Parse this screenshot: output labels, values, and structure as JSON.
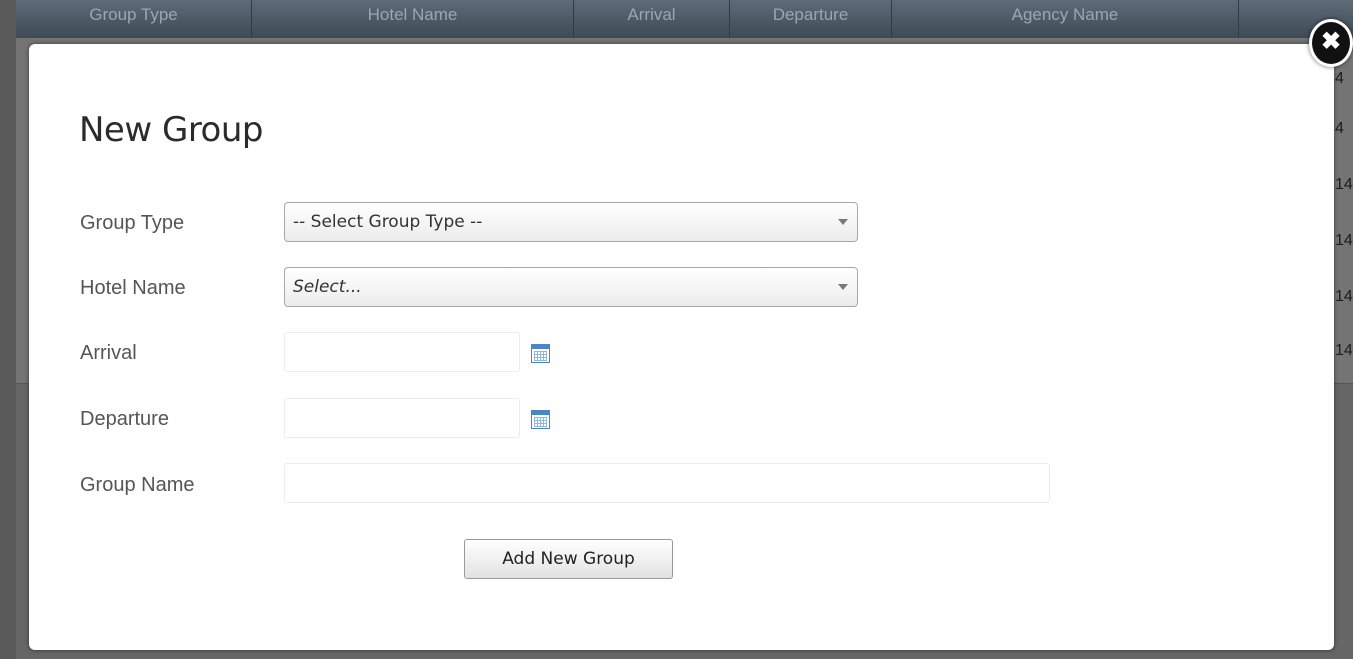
{
  "background_table": {
    "headers": [
      "Group Type",
      "Hotel Name",
      "Arrival",
      "Departure",
      "Agency Name"
    ],
    "row_fragments": [
      "4",
      "4",
      "14",
      "14",
      "14",
      "14"
    ]
  },
  "modal": {
    "title": "New Group",
    "close_icon": "close-icon",
    "fields": {
      "group_type": {
        "label": "Group Type",
        "selected": "-- Select Group Type --"
      },
      "hotel_name": {
        "label": "Hotel Name",
        "selected": "Select..."
      },
      "arrival": {
        "label": "Arrival",
        "value": "",
        "icon": "calendar-icon"
      },
      "departure": {
        "label": "Departure",
        "value": "",
        "icon": "calendar-icon"
      },
      "group_name": {
        "label": "Group Name",
        "value": ""
      }
    },
    "submit_label": "Add New Group"
  },
  "colors": {
    "overlay": "#5a5a5a",
    "header_bg": "#3e4a56",
    "calendar_blue": "#4a86c6",
    "modal_bg": "#ffffff"
  }
}
